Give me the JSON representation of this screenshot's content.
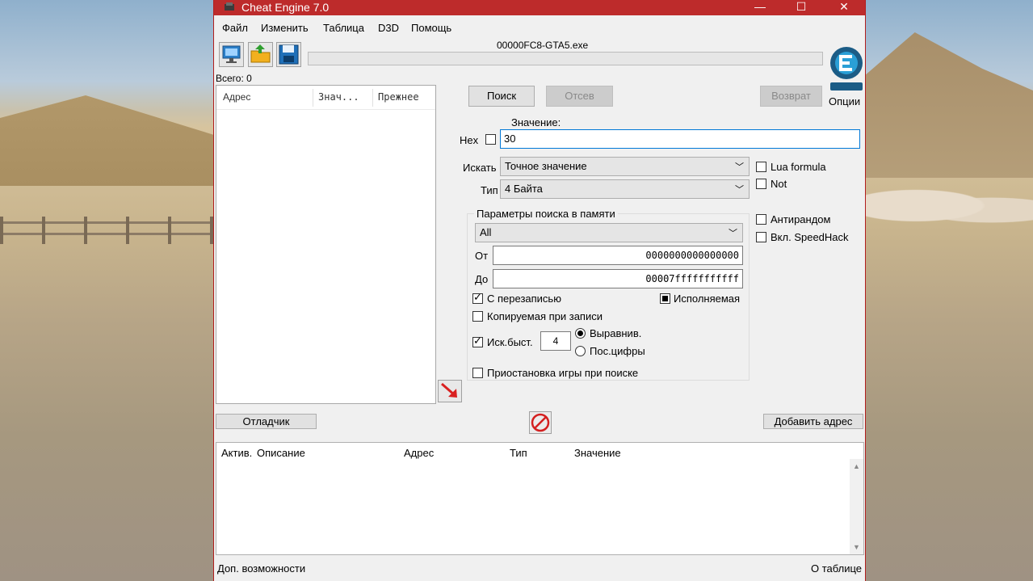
{
  "window": {
    "title": "Cheat Engine 7.0",
    "minimize": "—",
    "maximize": "☐",
    "close": "✕"
  },
  "menu": {
    "file": "Файл",
    "edit": "Изменить",
    "table": "Таблица",
    "d3d": "D3D",
    "help": "Помощь"
  },
  "process": {
    "name": "00000FC8-GTA5.exe",
    "progress": 0
  },
  "options_label": "Опции",
  "total_label": "Всего: 0",
  "results": {
    "col_address": "Адрес",
    "col_value": "Знач...",
    "col_previous": "Прежнее"
  },
  "scan": {
    "first_scan": "Поиск",
    "next_scan": "Отсев",
    "undo_scan": "Возврат"
  },
  "value": {
    "label": "Значение:",
    "hex_label": "Hex",
    "hex_checked": false,
    "text": "30"
  },
  "scan_type": {
    "label": "Искать",
    "selected": "Точное значение"
  },
  "value_type": {
    "label": "Тип",
    "selected": "4 Байта"
  },
  "side_options": {
    "lua_formula": "Lua formula",
    "not": "Not",
    "antirandom": "Антирандом",
    "speedhack": "Вкл. SpeedHack"
  },
  "memory": {
    "title": "Параметры поиска в памяти",
    "region": "All",
    "from_label": "От",
    "from_value": "0000000000000000",
    "to_label": "До",
    "to_value": "00007fffffffffff",
    "writable": "С перезаписью",
    "executable": "Исполняемая",
    "copy_on_write": "Копируемая при записи",
    "fast_scan": "Иск.быст.",
    "fast_scan_value": "4",
    "alignment": "Выравнив.",
    "last_digits": "Пос.цифры",
    "pause_game": "Приостановка игры при поиске"
  },
  "buttons": {
    "debugger": "Отладчик",
    "add_address": "Добавить адрес"
  },
  "address_table": {
    "active": "Актив.",
    "description": "Описание",
    "address": "Адрес",
    "type": "Тип",
    "value": "Значение"
  },
  "footer": {
    "advanced": "Доп. возможности",
    "about_table": "О таблице"
  },
  "colors": {
    "titlebar": "#bd2b2b",
    "accent": "#0078d7"
  }
}
